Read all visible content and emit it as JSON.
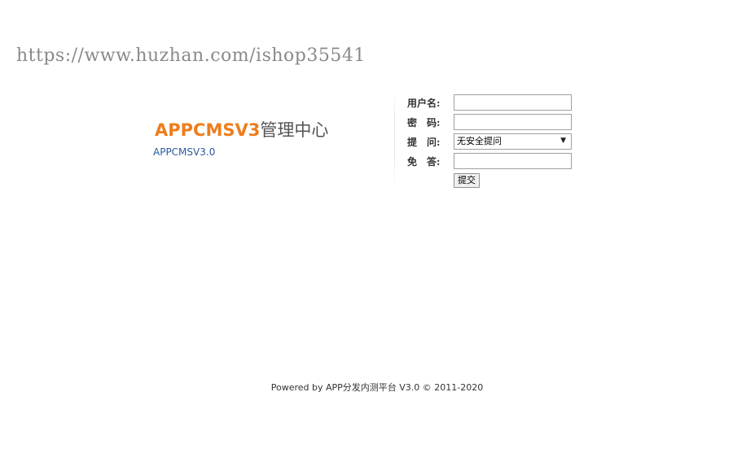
{
  "watermark": "https://www.huzhan.com/ishop35541",
  "brand": {
    "title_en": "APPCMSV3",
    "title_cn": "管理中心",
    "version": "APPCMSV3.0",
    "accent_color": "#ee7d1c"
  },
  "form": {
    "username_label": "用户名:",
    "username_value": "",
    "password_label": "密　码:",
    "password_value": "",
    "question_label": "提　问:",
    "question_selected": "无安全提问",
    "answer_label": "免　答:",
    "answer_value": "",
    "submit_label": "提交"
  },
  "footer": {
    "text": "Powered by APP分发内测平台 V3.0 © 2011-2020"
  },
  "icons": {
    "select_chevron": "chevron-down-icon"
  }
}
